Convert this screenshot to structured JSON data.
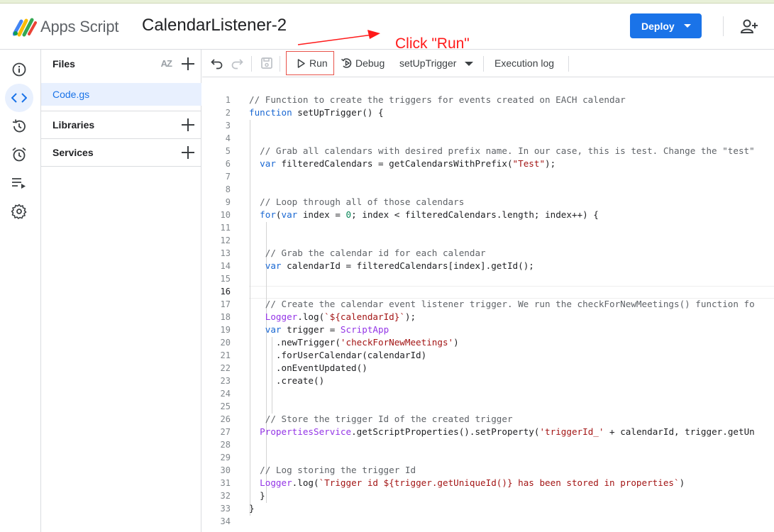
{
  "app": {
    "brand": "Apps Script",
    "project_title": "CalendarListener-2",
    "deploy_label": "Deploy"
  },
  "annotation": {
    "text": "Click \"Run\"",
    "color": "#ff1a1a"
  },
  "files_panel": {
    "files_label": "Files",
    "sort_label": "AZ",
    "file_name": "Code.gs",
    "libraries_label": "Libraries",
    "services_label": "Services"
  },
  "toolbar": {
    "run_label": "Run",
    "debug_label": "Debug",
    "function_select": "setUpTrigger",
    "execution_log_label": "Execution log"
  },
  "editor": {
    "current_line": 16,
    "line_numbers": [
      "1",
      "2",
      "3",
      "4",
      "5",
      "6",
      "7",
      "8",
      "9",
      "10",
      "11",
      "12",
      "13",
      "14",
      "15",
      "16",
      "17",
      "18",
      "19",
      "20",
      "21",
      "22",
      "23",
      "24",
      "25",
      "26",
      "27",
      "28",
      "29",
      "30",
      "31",
      "32",
      "33",
      "34"
    ],
    "lines": [
      "// Function to create the triggers for events created on EACH calendar",
      "function setUpTrigger() {",
      "",
      "",
      "  // Grab all calendars with desired prefix name. In our case, this is test. Change the \"test\"",
      "  var filteredCalendars = getCalendarsWithPrefix(\"Test\");",
      "",
      "",
      "  // Loop through all of those calendars",
      "  for(var index = 0; index < filteredCalendars.length; index++) {",
      "",
      "",
      "   // Grab the calendar id for each calendar",
      "   var calendarId = filteredCalendars[index].getId();",
      "",
      "",
      "   // Create the calendar event listener trigger. We run the checkForNewMeetings() function fo",
      "   Logger.log(`${calendarId}`);",
      "   var trigger = ScriptApp",
      "     .newTrigger('checkForNewMeetings')",
      "     .forUserCalendar(calendarId)",
      "     .onEventUpdated()",
      "     .create()",
      "",
      "",
      "   // Store the trigger Id of the created trigger",
      "  PropertiesService.getScriptProperties().setProperty('triggerId_' + calendarId, trigger.getUn",
      "",
      "",
      "  // Log storing the trigger Id",
      "  Logger.log(`Trigger id ${trigger.getUniqueId()} has been stored in properties`)",
      "  }",
      "}",
      ""
    ]
  },
  "colors": {
    "accent": "#1a73e8",
    "active_bg": "#e8f0fe",
    "comment": "#5f6368",
    "keyword": "#1967d2",
    "string": "#a31515",
    "number": "#098658",
    "object": "#9334e6"
  }
}
